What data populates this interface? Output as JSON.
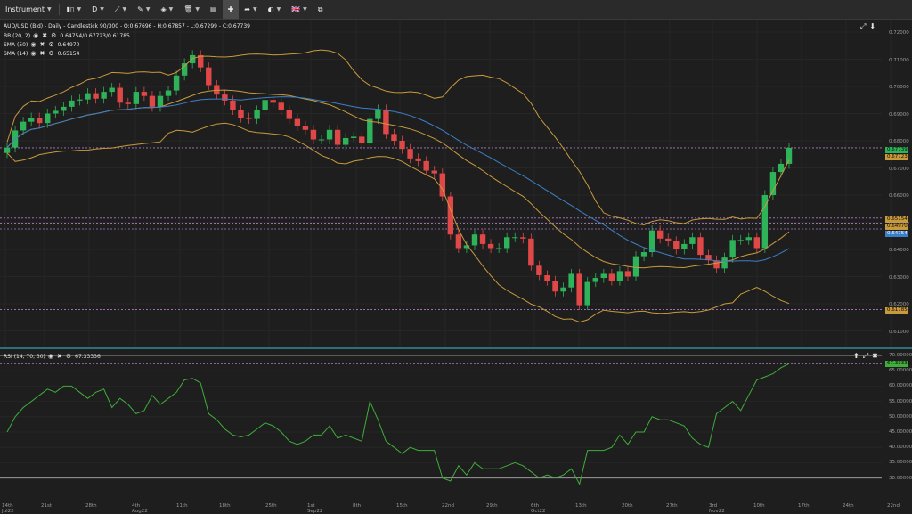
{
  "toolbar": {
    "instrument_label": "Instrument",
    "timeframe_label": "D",
    "flag_label": "🇬🇧"
  },
  "main_legend": {
    "title": "AUD/USD (Bid) - Daily - Candlestick  90/300 - O:0.67696 - H:0.67857 - L:0.67299 - C:0.67739",
    "bb": "BB (20, 2)",
    "bb_values": "0.64754/0.67723/0.61785",
    "sma50": "SMA (50)",
    "sma50_value": "0.64970",
    "sma14": "SMA (14)",
    "sma14_value": "0.65154"
  },
  "rsi_legend": {
    "label": "RSI (14, 70, 30)",
    "value": "67.33336"
  },
  "main_yaxis": [
    "0.72000",
    "0.71000",
    "0.70000",
    "0.69000",
    "0.68000",
    "0.67000",
    "0.66000",
    "0.65000",
    "0.64000",
    "0.63000",
    "0.62000",
    "0.61000"
  ],
  "main_badges": {
    "close": "0.67739",
    "bb_mid": "0.67723",
    "sma14": "0.65154",
    "sma50": "0.64970",
    "bb_upper": "0.64754",
    "bb_lower": "0.61785"
  },
  "rsi_yaxis": [
    "70.00000",
    "65.00000",
    "60.00000",
    "55.00000",
    "50.00000",
    "45.00000",
    "40.00000",
    "35.00000",
    "30.00000"
  ],
  "rsi_badge": "67.33336",
  "xaxis": [
    {
      "l1": "14th",
      "l2": "Jul22"
    },
    {
      "l1": "21st",
      "l2": ""
    },
    {
      "l1": "28th",
      "l2": ""
    },
    {
      "l1": "4th",
      "l2": "Aug22"
    },
    {
      "l1": "11th",
      "l2": ""
    },
    {
      "l1": "18th",
      "l2": ""
    },
    {
      "l1": "25th",
      "l2": ""
    },
    {
      "l1": "1st",
      "l2": "Sep22"
    },
    {
      "l1": "8th",
      "l2": ""
    },
    {
      "l1": "15th",
      "l2": ""
    },
    {
      "l1": "22nd",
      "l2": ""
    },
    {
      "l1": "29th",
      "l2": ""
    },
    {
      "l1": "6th",
      "l2": "Oct22"
    },
    {
      "l1": "13th",
      "l2": ""
    },
    {
      "l1": "20th",
      "l2": ""
    },
    {
      "l1": "27th",
      "l2": ""
    },
    {
      "l1": "3rd",
      "l2": "Nov22"
    },
    {
      "l1": "10th",
      "l2": ""
    },
    {
      "l1": "17th",
      "l2": ""
    },
    {
      "l1": "24th",
      "l2": ""
    },
    {
      "l1": "22nd",
      "l2": ""
    }
  ],
  "colors": {
    "bull": "#2fb35a",
    "bear": "#e04848",
    "bb": "#c89a3c",
    "sma50": "#3d7fc6",
    "sma14": "#c89a3c",
    "rsi": "#3fae3a",
    "level_line": "#b07ac7"
  }
}
